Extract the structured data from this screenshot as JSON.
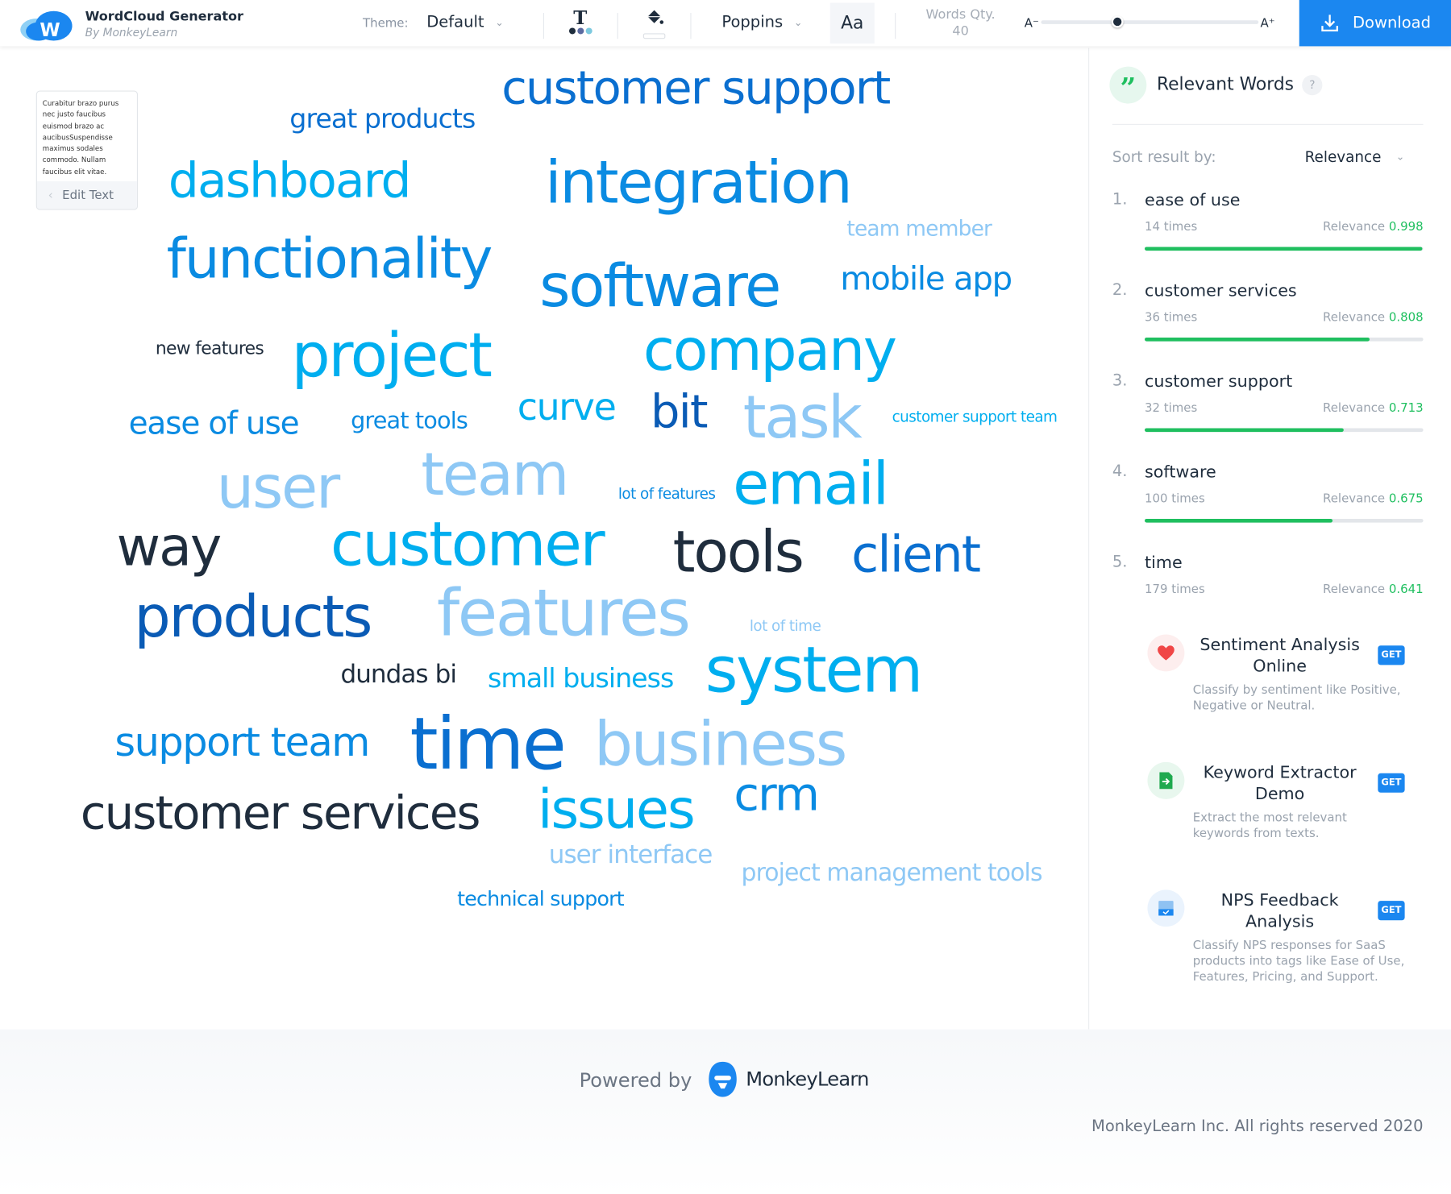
{
  "header": {
    "app_title": "WordCloud Generator",
    "app_subtitle": "By MonkeyLearn",
    "theme_label": "Theme:",
    "theme_value": "Default",
    "font_value": "Poppins",
    "font_case_label": "Aa",
    "words_qty_label": "Words Qty.",
    "words_qty_value": "40",
    "size_min_label": "A⁻",
    "size_max_label": "A⁺",
    "size_slider_level": 0.35,
    "download_label": "Download",
    "color_dots": [
      "#1f2d3d",
      "#5b6aa0",
      "#7cc9df"
    ]
  },
  "text_preview": {
    "text": "Curabitur brazo purus nec justo faucibus euismod brazo ac aucibusSuspendisse maximus sodales commodo. Nullam faucibus elit vitae.",
    "edit_label": "Edit Text"
  },
  "colors": {
    "navy": "#1f2d3d",
    "dark_blue": "#0a5bb5",
    "blue": "#0a6fd0",
    "mid_blue": "#0a8be2",
    "cyan": "#00aeef",
    "light_blue": "#8ec8f5",
    "accent": "#1b87f0",
    "green": "#1fbf5f"
  },
  "wordcloud": [
    {
      "text": "customer support",
      "color": "blue"
    },
    {
      "text": "great products",
      "color": "blue"
    },
    {
      "text": "dashboard",
      "color": "cyan"
    },
    {
      "text": "integration",
      "color": "mid_blue"
    },
    {
      "text": "team member",
      "color": "light_blue"
    },
    {
      "text": "functionality",
      "color": "mid_blue"
    },
    {
      "text": "software",
      "color": "mid_blue"
    },
    {
      "text": "mobile app",
      "color": "mid_blue"
    },
    {
      "text": "new features",
      "color": "navy"
    },
    {
      "text": "project",
      "color": "cyan"
    },
    {
      "text": "company",
      "color": "cyan"
    },
    {
      "text": "ease of use",
      "color": "mid_blue"
    },
    {
      "text": "great tools",
      "color": "mid_blue"
    },
    {
      "text": "curve",
      "color": "cyan"
    },
    {
      "text": "bit",
      "color": "dark_blue"
    },
    {
      "text": "task",
      "color": "light_blue"
    },
    {
      "text": "customer support team",
      "color": "cyan"
    },
    {
      "text": "user",
      "color": "light_blue"
    },
    {
      "text": "team",
      "color": "light_blue"
    },
    {
      "text": "lot of features",
      "color": "mid_blue"
    },
    {
      "text": "email",
      "color": "cyan"
    },
    {
      "text": "way",
      "color": "navy"
    },
    {
      "text": "customer",
      "color": "cyan"
    },
    {
      "text": "tools",
      "color": "navy"
    },
    {
      "text": "client",
      "color": "blue"
    },
    {
      "text": "products",
      "color": "dark_blue"
    },
    {
      "text": "features",
      "color": "light_blue"
    },
    {
      "text": "lot of time",
      "color": "light_blue"
    },
    {
      "text": "dundas bi",
      "color": "navy"
    },
    {
      "text": "small business",
      "color": "cyan"
    },
    {
      "text": "system",
      "color": "cyan"
    },
    {
      "text": "support team",
      "color": "mid_blue"
    },
    {
      "text": "time",
      "color": "blue"
    },
    {
      "text": "business",
      "color": "light_blue"
    },
    {
      "text": "customer services",
      "color": "navy"
    },
    {
      "text": "issues",
      "color": "cyan"
    },
    {
      "text": "crm",
      "color": "mid_blue"
    },
    {
      "text": "user interface",
      "color": "light_blue"
    },
    {
      "text": "project management tools",
      "color": "light_blue"
    },
    {
      "text": "technical support",
      "color": "mid_blue"
    }
  ],
  "sidebar": {
    "title": "Relevant Words",
    "help": "?",
    "sort_label": "Sort result by:",
    "sort_value": "Relevance",
    "relevance_label": "Relevance",
    "items": [
      {
        "rank": "1.",
        "word": "ease of use",
        "times": "14 times",
        "relevance": "0.998",
        "show_bar": true
      },
      {
        "rank": "2.",
        "word": "customer services",
        "times": "36 times",
        "relevance": "0.808",
        "show_bar": true
      },
      {
        "rank": "3.",
        "word": "customer support",
        "times": "32 times",
        "relevance": "0.713",
        "show_bar": true
      },
      {
        "rank": "4.",
        "word": "software",
        "times": "100 times",
        "relevance": "0.675",
        "show_bar": true
      },
      {
        "rank": "5.",
        "word": "time",
        "times": "179 times",
        "relevance": "0.641",
        "show_bar": false
      }
    ],
    "cards": [
      {
        "icon": "heart-icon",
        "title": "Sentiment Analysis Online",
        "button": "GET",
        "desc": "Classify by sentiment like Positive, Negative or Neutral."
      },
      {
        "icon": "document-arrow-icon",
        "title": "Keyword Extractor Demo",
        "button": "GET",
        "desc": "Extract the most relevant keywords from texts."
      },
      {
        "icon": "form-check-icon",
        "title": "NPS Feedback Analysis",
        "button": "GET",
        "desc": "Classify NPS responses for SaaS products into tags like Ease of Use, Features, Pricing, and Support."
      }
    ]
  },
  "footer": {
    "powered_by": "Powered by",
    "brand": "MonkeyLearn",
    "copyright": "MonkeyLearn Inc. All rights reserved 2020"
  }
}
